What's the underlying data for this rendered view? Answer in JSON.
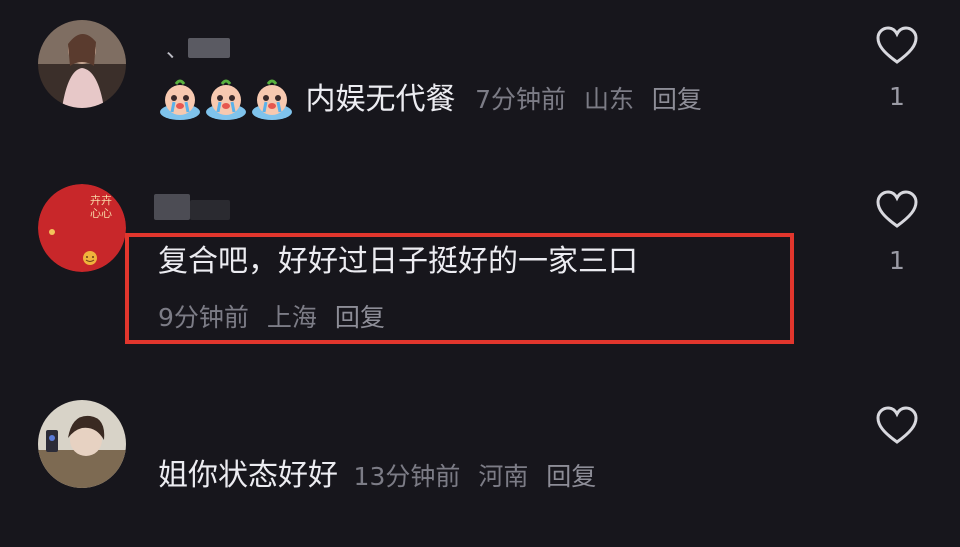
{
  "comments": [
    {
      "username_visible": "、",
      "text": "内娱无代餐",
      "emojis": [
        "crying-emoji",
        "crying-emoji",
        "crying-emoji"
      ],
      "time": "7分钟前",
      "location": "山东",
      "reply_label": "回复",
      "like_count": "1"
    },
    {
      "avatar_text": "卉卉心心",
      "text": "复合吧，好好过日子挺好的一家三口",
      "time": "9分钟前",
      "location": "上海",
      "reply_label": "回复",
      "like_count": "1"
    },
    {
      "text": "姐你状态好好",
      "time": "13分钟前",
      "location": "河南",
      "reply_label": "回复",
      "like_count": ""
    }
  ],
  "colors": {
    "background": "#17161c",
    "highlight_border": "#e2362d",
    "meta_text": "#7c7c86",
    "primary_text": "#ececf1"
  }
}
